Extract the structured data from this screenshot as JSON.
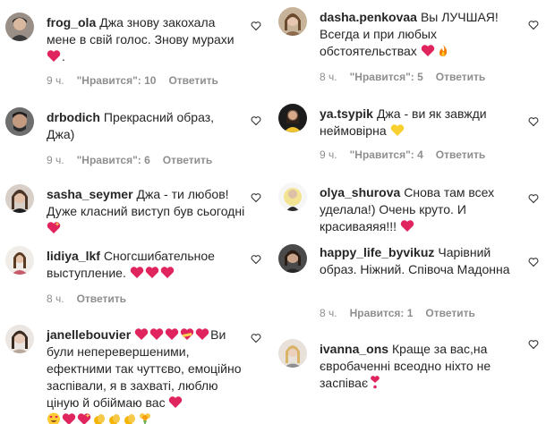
{
  "colors": {
    "text": "#262626",
    "meta": "#8e8e8e",
    "heart_red": "#e0245e",
    "yellow_heart": "#f8d030",
    "fire": "#f57c00",
    "clap": "#f4b400",
    "bouquet": "#6ab04c"
  },
  "left": {
    "comments": [
      {
        "username": "frog_ola",
        "text": "Джа знову закохала мене в свій голос. Знову мурахи",
        "after": ".",
        "time": "9 ч.",
        "likes": "\"Нравится\": 10",
        "reply": "Ответить",
        "emoji": [
          "heart-icon"
        ]
      },
      {
        "username": "drbodich",
        "text": "Прекрасний образ, Джа)",
        "time": "9 ч.",
        "likes": "\"Нравится\": 6",
        "reply": "Ответить"
      },
      {
        "username": "sasha_seymer",
        "text": "Джа - ти любов! Дуже класний виступ був сьогодні",
        "emoji": [
          "sparkle-heart-icon"
        ]
      },
      {
        "username": "lidiya_lkf",
        "text": "Сногсшибательное выступление.",
        "time": "8 ч.",
        "reply": "Ответить",
        "emoji": [
          "heart-icon",
          "heart-icon",
          "heart-icon"
        ]
      },
      {
        "username": "janellebouvier",
        "text": "Ви були неперевершеними, ефектними так чуттєво, емоційно заспівали, я в захваті, люблю ціную й обіймаю вас",
        "emoji_top": [
          "heart-icon",
          "heart-icon",
          "heart-icon",
          "heart-ribbon-icon",
          "heart-icon"
        ],
        "emoji": [
          "heart-icon"
        ],
        "emoji_row2": [
          "heart-eyes-icon",
          "heart-icon",
          "sparkle-heart-icon",
          "clap-icon",
          "clap-icon",
          "clap-icon",
          "bouquet-icon"
        ]
      }
    ]
  },
  "right": {
    "comments": [
      {
        "username": "dasha.penkovaa",
        "text": "Вы ЛУЧШАЯ! Всегда и при любых обстоятельствах",
        "time": "8 ч.",
        "likes": "\"Нравится\": 5",
        "reply": "Ответить",
        "emoji": [
          "heart-icon",
          "fire-icon"
        ]
      },
      {
        "username": "ya.tsypik",
        "text": "Джа - ви як завжди неймовірна",
        "time": "9 ч.",
        "likes": "\"Нравится\": 4",
        "reply": "Ответить",
        "emoji": [
          "yellow-heart-icon"
        ]
      },
      {
        "username": "olya_shurova",
        "text": "Снова там всех уделала!) Очень круто. И красиваяяя!!!",
        "emoji": [
          "heart-icon"
        ]
      },
      {
        "username": "happy_life_byvikuz",
        "text": "Чарівний образ. Ніжний. Співоча Мадонна",
        "time": "8 ч.",
        "likes": "Нравится: 1",
        "reply": "Ответить"
      },
      {
        "username": "ivanna_ons",
        "text": "Краще за вас,на євробаченні всеодно ніхто не заспіває",
        "emoji": [
          "heart-exclamation-icon"
        ]
      }
    ]
  }
}
